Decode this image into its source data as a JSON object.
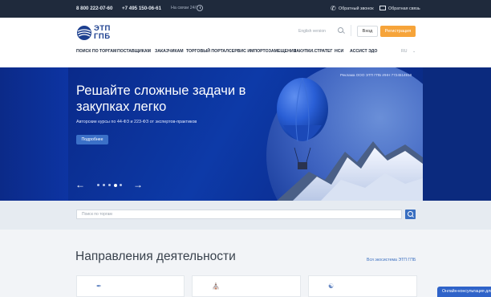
{
  "topbar": {
    "phone_main": "8 800 222-07-60",
    "phone_msk": "+7 495 150-06-61",
    "hotline": "На связи 24/7",
    "callback": "Обратный звонок",
    "feedback": "Обратная связь"
  },
  "header": {
    "logo_line1": "ЭТП",
    "logo_line2": "ГПБ",
    "english": "English version",
    "login": "Вход",
    "register": "Регистрация",
    "lang": "RU"
  },
  "nav": {
    "items": [
      "ПОИСК ПО ТОРГАМ",
      "ПОСТАВЩИКАМ",
      "ЗАКАЗЧИКАМ",
      "ТОРГОВЫЙ ПОРТАЛ",
      "СЕРВИС ИМПОРТОЗАМЕЩЕНИЯ",
      "ЗАКУПКИ.СТРАТЕГ",
      "НСИ",
      "АССИСТ ЭДО"
    ]
  },
  "hero": {
    "title": "Решайте сложные задачи в закупках легко",
    "subtitle": "Авторские курсы по 44-ФЗ и 223-ФЗ от экспертов-практиков",
    "button": "Подробнее",
    "ad_note": "Реклама ООО ЭТП ГПБ ИНН 7724514910",
    "arrow_prev": "←",
    "arrow_next": "→",
    "slide_count": 5,
    "active_slide": 4
  },
  "search": {
    "placeholder": "Поиск по торгам"
  },
  "directions": {
    "title": "Направления деятельности",
    "link": "Вся экосистема ЭТП ГПБ"
  },
  "consult": {
    "label": "Онлайн-консультация для"
  },
  "colors": {
    "topbar": "#1f2a3c",
    "accent_orange": "#f6a43a",
    "brand_blue": "#1c3f8f",
    "hero_blue": "#0d3aa8"
  }
}
